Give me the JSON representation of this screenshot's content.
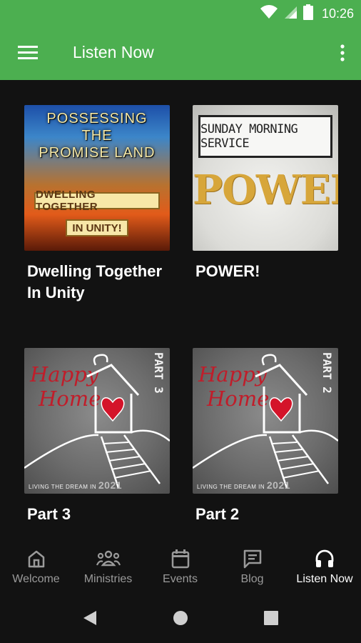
{
  "status_bar": {
    "time": "10:26",
    "icons": [
      "wifi-icon",
      "signal-icon",
      "battery-icon"
    ]
  },
  "app_bar": {
    "title": "Listen Now",
    "menu_icon": "menu-icon",
    "overflow_icon": "more-vert-icon"
  },
  "cards": [
    {
      "title": "Dwelling Together In Unity",
      "art": {
        "lines": [
          "POSSESSING",
          "THE",
          "PROMISE LAND"
        ],
        "box1": "DWELLING TOGETHER",
        "box2": "IN UNITY!"
      }
    },
    {
      "title": "POWER!",
      "art": {
        "banner": "SUNDAY MORNING SERVICE",
        "word": "POWER!"
      }
    },
    {
      "title": "Part 3",
      "art": {
        "line1": "Happy",
        "line2": "Home",
        "part": "PART 3",
        "footer": "LIVING THE DREAM IN",
        "year": "2021"
      }
    },
    {
      "title": "Part 2",
      "art": {
        "line1": "Happy",
        "line2": "Home",
        "part": "PART 2",
        "footer": "LIVING THE DREAM IN",
        "year": "2021"
      }
    }
  ],
  "bottom_nav": [
    {
      "label": "Welcome",
      "icon": "home-icon",
      "active": false
    },
    {
      "label": "Ministries",
      "icon": "groups-icon",
      "active": false
    },
    {
      "label": "Events",
      "icon": "calendar-icon",
      "active": false
    },
    {
      "label": "Blog",
      "icon": "chat-icon",
      "active": false
    },
    {
      "label": "Listen Now",
      "icon": "headphones-icon",
      "active": true
    }
  ],
  "system_nav": [
    "back-icon",
    "home-circle-icon",
    "recents-icon"
  ],
  "colors": {
    "app_bar": "#4caf50",
    "background": "#121212",
    "inactive_nav": "#9a9a9a",
    "active_nav": "#ffffff"
  }
}
